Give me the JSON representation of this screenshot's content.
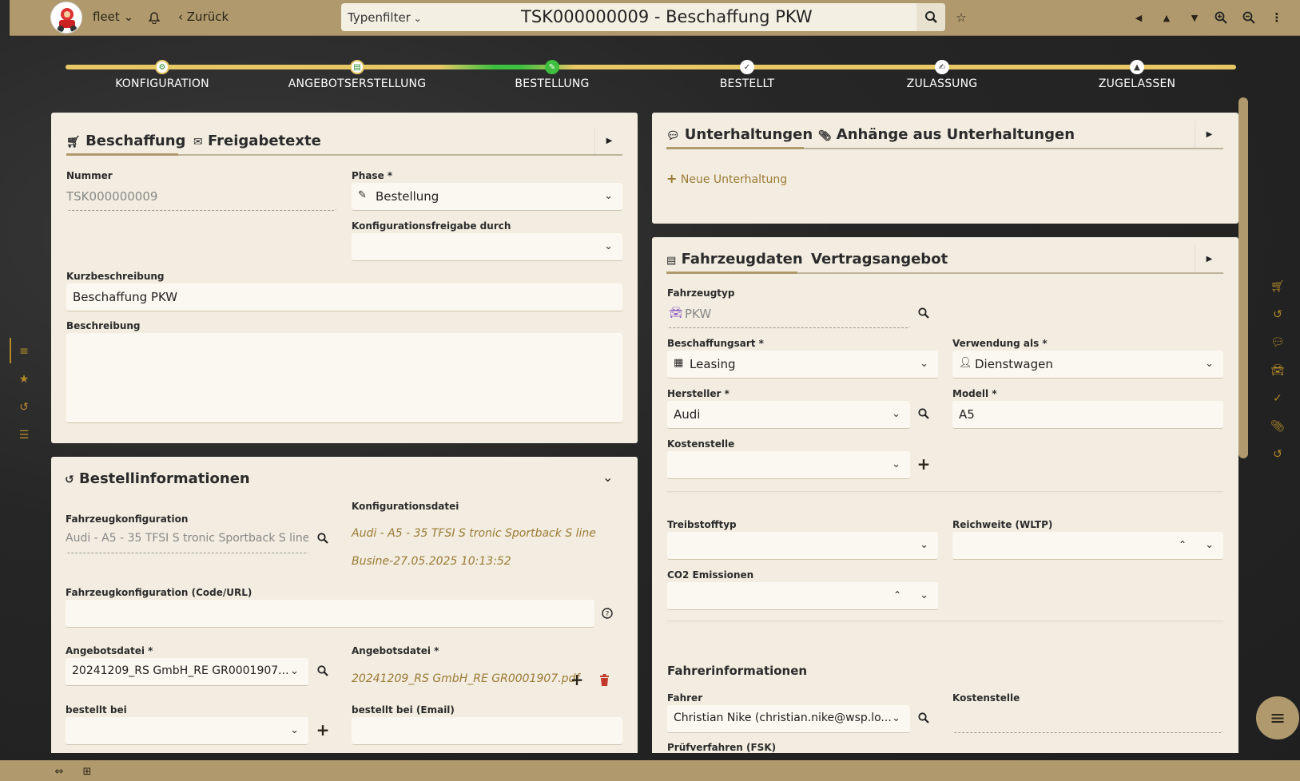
{
  "header": {
    "workspace": "fleet",
    "back": "Zurück",
    "type_filter": "Typenfilter",
    "title": "TSK000000009 - Beschaffung PKW"
  },
  "steps": [
    {
      "label": "KONFIGURATION"
    },
    {
      "label": "ANGEBOTSERSTELLUNG"
    },
    {
      "label": "BESTELLUNG"
    },
    {
      "label": "BESTELLT"
    },
    {
      "label": "ZULASSUNG"
    },
    {
      "label": "ZUGELASSEN"
    }
  ],
  "beschaffung": {
    "tab1": "Beschaffung",
    "tab2": "Freigabetexte",
    "nummer_label": "Nummer",
    "nummer": "TSK000000009",
    "phase_label": "Phase *",
    "phase": "Bestellung",
    "konf_label": "Konfigurationsfreigabe durch",
    "konf": "",
    "kurz_label": "Kurzbeschreibung",
    "kurz": "Beschaffung PKW",
    "beschr_label": "Beschreibung",
    "beschr": ""
  },
  "bestell": {
    "title": "Bestellinformationen",
    "fk_label": "Fahrzeugkonfiguration",
    "fk": "Audi - A5 - 35 TFSI S tronic Sportback S line ...",
    "kd_label": "Konfigurationsdatei",
    "kd_line1": "Audi - A5 - 35 TFSI S tronic Sportback S line",
    "kd_line2": "Busine-27.05.2025 10:13:52",
    "fkurl_label": "Fahrzeugkonfiguration (Code/URL)",
    "fkurl": "",
    "ang_label": "Angebotsdatei *",
    "ang": "20241209_RS GmbH_RE GR0001907....",
    "ang2_label": "Angebotsdatei *",
    "ang2": "20241209_RS GmbH_RE GR0001907.pdf",
    "bei_label": "bestellt bei",
    "bei": "",
    "email_label": "bestellt bei (Email)",
    "email": ""
  },
  "unterhaltungen": {
    "tab1": "Unterhaltungen",
    "tab2": "Anhänge aus Unterhaltungen",
    "new": "Neue Unterhaltung"
  },
  "fahrzeug": {
    "tab1": "Fahrzeugdaten",
    "tab2": "Vertragsangebot",
    "typ_label": "Fahrzeugtyp",
    "typ": "PKW",
    "art_label": "Beschaffungsart *",
    "art": "Leasing",
    "verw_label": "Verwendung als *",
    "verw": "Dienstwagen",
    "herst_label": "Hersteller *",
    "herst": "Audi",
    "modell_label": "Modell *",
    "modell": "A5",
    "kst_label": "Kostenstelle",
    "kst": "",
    "treib_label": "Treibstofftyp",
    "treib": "",
    "reich_label": "Reichweite (WLTP)",
    "reich": "",
    "co2_label": "CO2 Emissionen",
    "co2": "",
    "fahrer_section": "Fahrerinformationen",
    "fahrer_label": "Fahrer",
    "fahrer": "Christian Nike (christian.nike@wsp.lo...",
    "kst2_label": "Kostenstelle",
    "kst2": "",
    "pruef_label": "Prüfverfahren (FSK)"
  }
}
